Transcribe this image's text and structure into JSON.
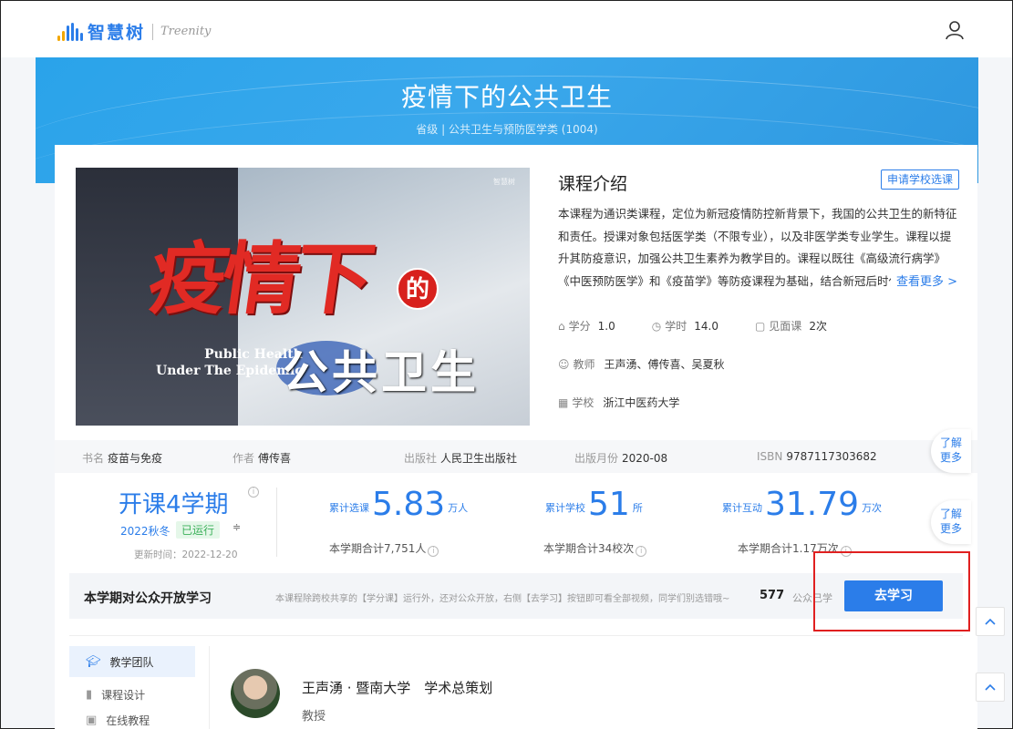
{
  "header": {
    "logo_text": "智慧树",
    "logo_en": "Treenity",
    "logo_url_text": "www.zhihuishu.com",
    "user_icon": "user-icon"
  },
  "banner": {
    "title": "疫情下的公共卫生",
    "subtitle": "省级 | 公共卫生与预防医学类 (1004)"
  },
  "cover": {
    "big_text": "疫情下",
    "de": "的",
    "en_line1": "Public Health",
    "en_line2": "Under The Epidemic",
    "cn_line2": "公共卫生",
    "brand": "智慧树"
  },
  "intro": {
    "title": "课程介绍",
    "apply_label": "申请学校选课",
    "text": "本课程为通识类课程，定位为新冠疫情防控新背景下，我国的公共卫生的新特征和责任。授课对象包括医学类（不限专业），以及非医学类专业学生。课程以提升其防疫意识，加强公共卫生素养为教学目的。课程以既往《高级流行病学》《中医预防医学》和《疫苗学》等防疫课程为基础，结合新冠后时代的新",
    "see_more": "查看更多 >",
    "credit_label": "学分",
    "credit_value": "1.0",
    "hours_label": "学时",
    "hours_value": "14.0",
    "meet_label": "见面课",
    "meet_value": "2次",
    "teacher_label": "教师",
    "teacher_value": "王声湧、傅传喜、吴夏秋",
    "school_label": "学校",
    "school_value": "浙江中医药大学"
  },
  "book": {
    "name_label": "书名",
    "name_value": "疫苗与免疫",
    "author_label": "作者",
    "author_value": "傅传喜",
    "publisher_label": "出版社",
    "publisher_value": "人民卫生出版社",
    "date_label": "出版月份",
    "date_value": "2020-08",
    "isbn_label": "ISBN",
    "isbn_value": "9787117303682"
  },
  "stats": {
    "term_count": "开课4学期",
    "term_info": "i",
    "semester": "2022秋冬",
    "status_badge": "已运行",
    "sort_icon": "≑",
    "updated": "更新时间：2022-12-20",
    "enroll_label": "累计选课",
    "enroll_value": "5.83",
    "enroll_unit": "万人",
    "enroll_sub": "本学期合计7,751人",
    "schools_label": "累计学校",
    "schools_value": "51",
    "schools_unit": "所",
    "schools_sub": "本学期合计34校次",
    "interact_label": "累计互动",
    "interact_value": "31.79",
    "interact_unit": "万次",
    "interact_sub": "本学期合计1.17万次",
    "info_glyph": "i"
  },
  "public": {
    "title": "本学期对公众开放学习",
    "desc": "本课程除跨校共享的【学分课】运行外，还对公众开放，右侧【去学习】按钮即可看全部视频，同学们别选错哦~",
    "count": "577",
    "count_label": "公众已学",
    "study_label": "去学习"
  },
  "nav": {
    "items": [
      {
        "label": "教学团队",
        "icon": "graduation-cap-icon"
      },
      {
        "label": "课程设计",
        "icon": "bookmark-icon"
      },
      {
        "label": "在线教程",
        "icon": "monitor-icon"
      }
    ]
  },
  "teacher": {
    "name": "王声湧 · 暨南大学　学术总策划",
    "title": "教授"
  },
  "float": {
    "more_label_1": "了解",
    "more_label_2": "更多"
  },
  "colors": {
    "brand_blue": "#2b7de9",
    "banner_blue": "#2a9fe6",
    "status_green": "#3cb15a",
    "highlight_red": "#e02020"
  }
}
